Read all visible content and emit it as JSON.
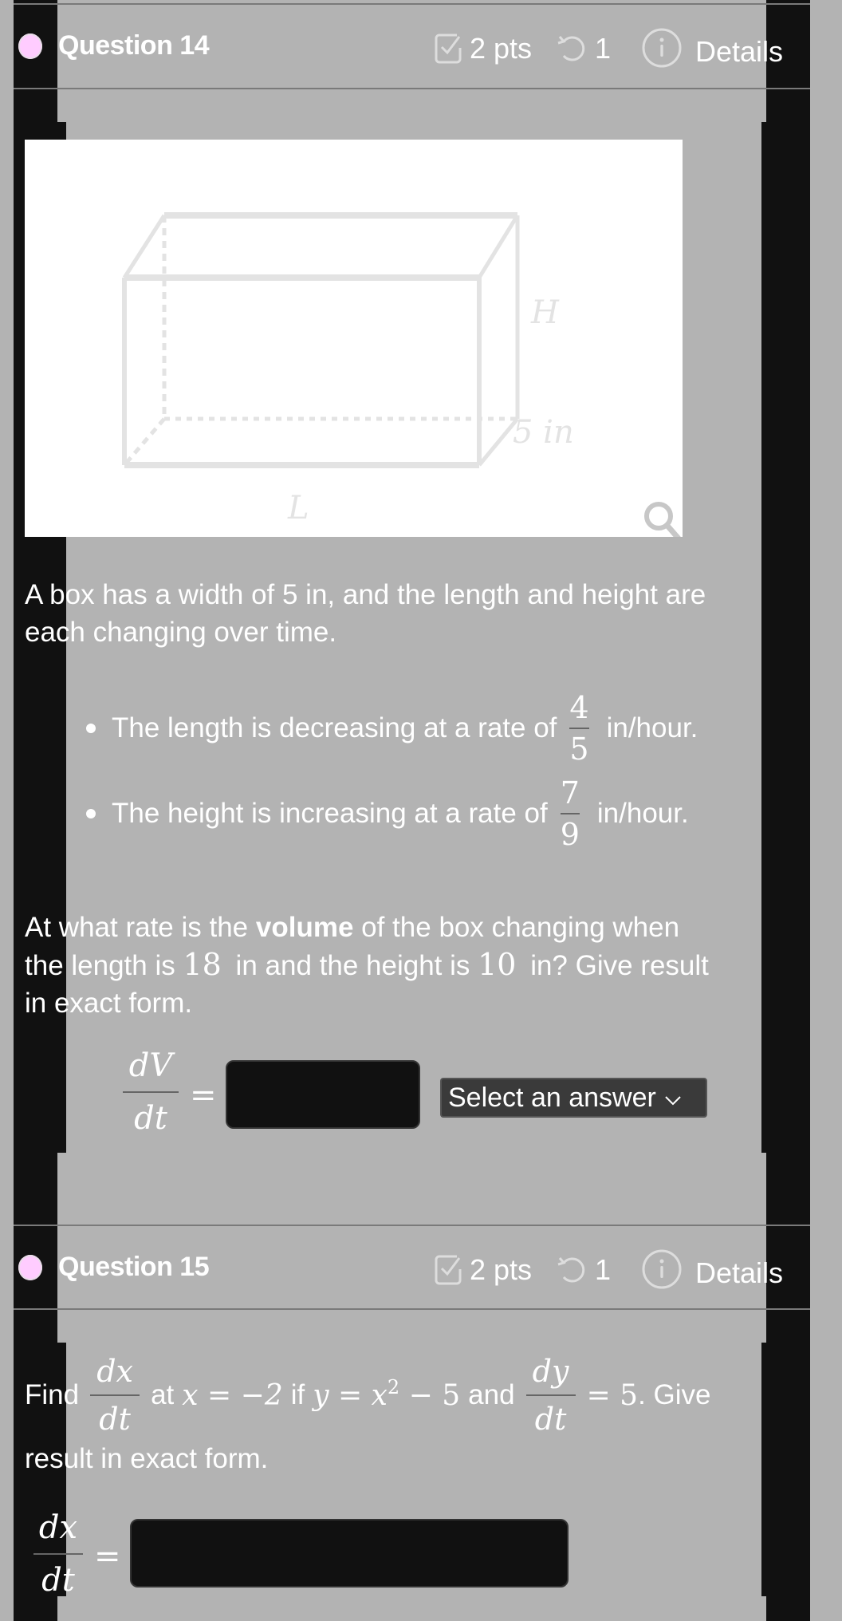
{
  "questions": [
    {
      "title": "Question 14",
      "points": "2 pts",
      "attempts": "1",
      "details_label": "Details",
      "status_color": "#ffccff",
      "diagram": {
        "label_height": "H",
        "label_width": "5 in",
        "label_length": "L",
        "zoom_icon": "magnifier-icon"
      },
      "intro": "A box has a width of 5 in, and the length and height are each changing over time.",
      "intro_line1": "A box has a width of 5 in, and the length and height are",
      "intro_line2": "each changing over time.",
      "bullets": [
        {
          "text": "The length is decreasing at a rate of",
          "num": "4",
          "den": "5",
          "unit": "in/hour."
        },
        {
          "text": "The height is increasing at a rate of",
          "num": "7",
          "den": "9",
          "unit": "in/hour."
        }
      ],
      "question_parts": {
        "l1_pre": "At what rate is the ",
        "l1_bold": "volume",
        "l1_post": " of the box changing when",
        "l2_a": "the length is ",
        "l2_len": "18",
        "l2_b": " in and the height is ",
        "l2_h": "10",
        "l2_c": " in? Give result",
        "l3": "in exact form."
      },
      "answer": {
        "lhs_num": "dV",
        "lhs_den": "dt",
        "equals": "=",
        "value": "",
        "unit_select": "Select an answer"
      }
    },
    {
      "title": "Question 15",
      "points": "2 pts",
      "attempts": "1",
      "details_label": "Details",
      "status_color": "#ffccff",
      "prompt": {
        "find": "Find",
        "f1_num": "dx",
        "f1_den": "dt",
        "at": "at",
        "cond_x": "x = −2",
        "if": "if",
        "eq_y": "y = x",
        "exp": "2",
        "eq_tail": " − 5",
        "and": "and",
        "f2_num": "dy",
        "f2_den": "dt",
        "eq_val": "= 5",
        "give": ". Give",
        "line2": "result in exact form."
      },
      "answer": {
        "lhs_num": "dx",
        "lhs_den": "dt",
        "equals": "=",
        "value": ""
      }
    }
  ]
}
